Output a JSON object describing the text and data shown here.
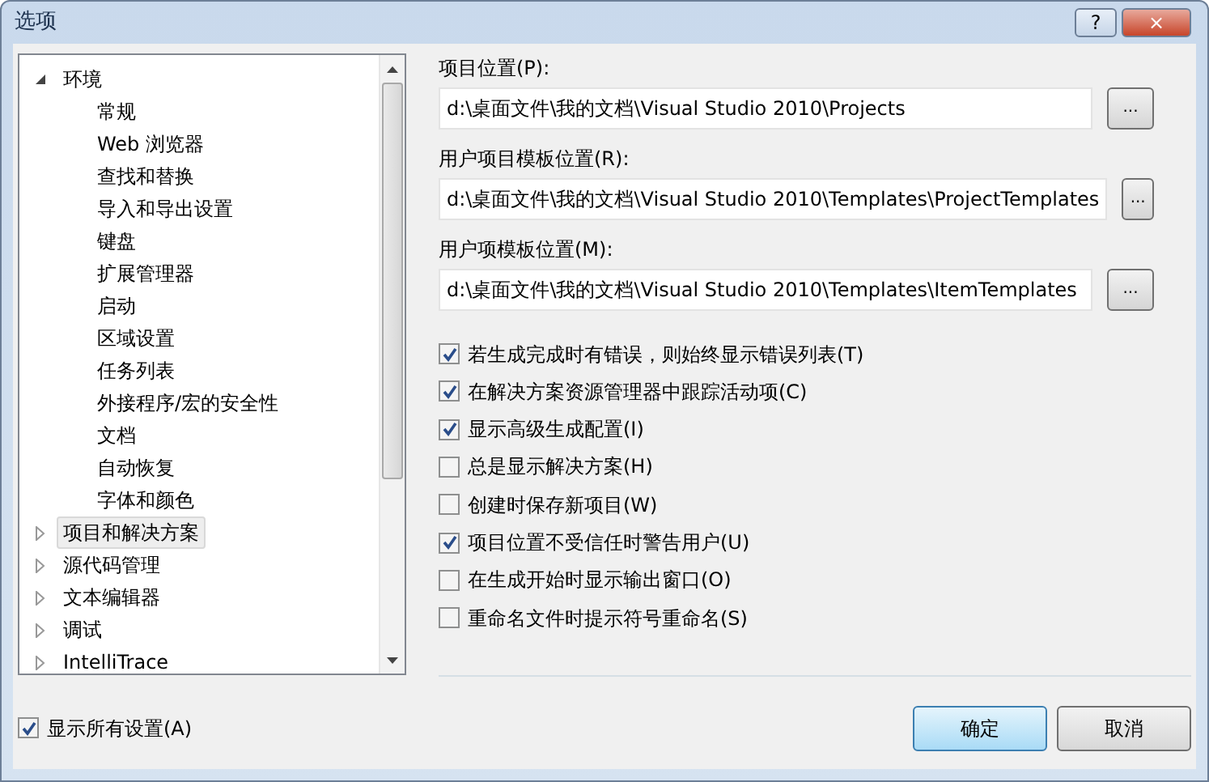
{
  "window": {
    "title": "选项",
    "buttons": [
      "?",
      "×"
    ]
  },
  "tree": [
    {
      "label": "环境",
      "expanded": true,
      "selected": false,
      "children": [
        {
          "label": "常规",
          "selected": false
        },
        {
          "label": "Web 浏览器",
          "selected": false
        },
        {
          "label": "查找和替换",
          "selected": false
        },
        {
          "label": "导入和导出设置",
          "selected": false
        },
        {
          "label": "键盘",
          "selected": false
        },
        {
          "label": "扩展管理器",
          "selected": false
        },
        {
          "label": "启动",
          "selected": false
        },
        {
          "label": "区域设置",
          "selected": false
        },
        {
          "label": "任务列表",
          "selected": false
        },
        {
          "label": "外接程序/宏的安全性",
          "selected": false
        },
        {
          "label": "文档",
          "selected": false
        },
        {
          "label": "自动恢复",
          "selected": false
        },
        {
          "label": "字体和颜色",
          "selected": false
        }
      ]
    },
    {
      "label": "项目和解决方案",
      "expanded": false,
      "selected": true
    },
    {
      "label": "源代码管理",
      "expanded": false,
      "selected": false
    },
    {
      "label": "文本编辑器",
      "expanded": false,
      "selected": false
    },
    {
      "label": "调试",
      "expanded": false,
      "selected": false
    },
    {
      "label": "IntelliTrace",
      "expanded": false,
      "selected": false
    }
  ],
  "fields": [
    {
      "label": "项目位置(P):",
      "value": "d:\\桌面文件\\我的文档\\Visual Studio 2010\\Projects",
      "button": "..."
    },
    {
      "label": "用户项目模板位置(R):",
      "value": "d:\\桌面文件\\我的文档\\Visual Studio 2010\\Templates\\ProjectTemplates",
      "button": "..."
    },
    {
      "label": "用户项模板位置(M):",
      "value": "d:\\桌面文件\\我的文档\\Visual Studio 2010\\Templates\\ItemTemplates",
      "button": "..."
    }
  ],
  "options": [
    {
      "label": "若生成完成时有错误，则始终显示错误列表(T)",
      "checked": true
    },
    {
      "label": "在解决方案资源管理器中跟踪活动项(C)",
      "checked": true
    },
    {
      "label": "显示高级生成配置(I)",
      "checked": true
    },
    {
      "label": "总是显示解决方案(H)",
      "checked": false
    },
    {
      "label": "创建时保存新项目(W)",
      "checked": false
    },
    {
      "label": "项目位置不受信任时警告用户(U)",
      "checked": true
    },
    {
      "label": "在生成开始时显示输出窗口(O)",
      "checked": false
    },
    {
      "label": "重命名文件时提示符号重命名(S)",
      "checked": false
    }
  ],
  "show_all": {
    "label": "显示所有设置(A)",
    "checked": true
  },
  "buttons": [
    {
      "label": "确定",
      "default": true
    },
    {
      "label": "取消",
      "default": false
    }
  ]
}
